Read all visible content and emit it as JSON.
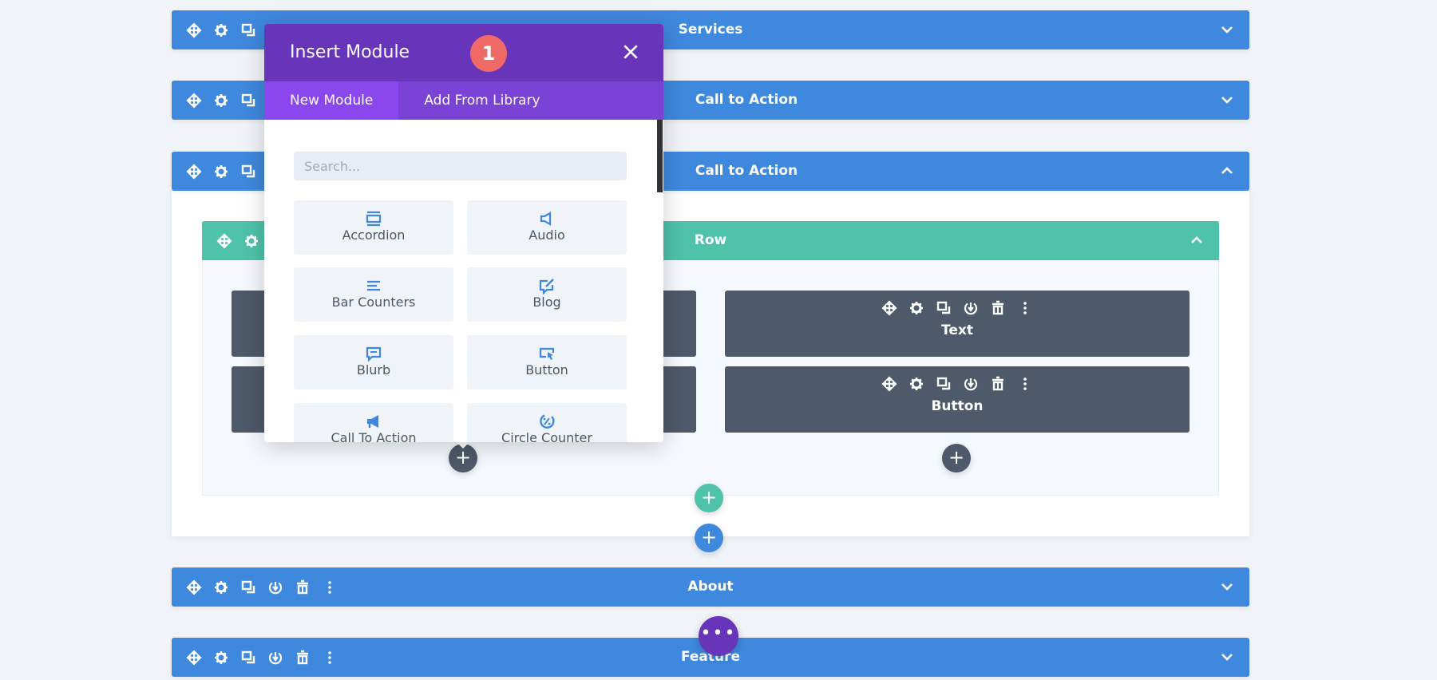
{
  "sections": [
    {
      "title": "Services",
      "expanded": false
    },
    {
      "title": "Call to Action",
      "expanded": false
    },
    {
      "title": "Call to Action",
      "expanded": true
    },
    {
      "title": "About",
      "expanded": false
    },
    {
      "title": "Feature",
      "expanded": false
    }
  ],
  "row": {
    "title": "Row"
  },
  "modules": {
    "right_column": [
      "Text",
      "Button"
    ]
  },
  "modal": {
    "title": "Insert Module",
    "step_badge": "1",
    "tabs": [
      {
        "label": "New Module",
        "active": true
      },
      {
        "label": "Add From Library",
        "active": false
      }
    ],
    "search_placeholder": "Search...",
    "items": [
      {
        "label": "Accordion",
        "icon": "accordion-icon"
      },
      {
        "label": "Audio",
        "icon": "audio-icon"
      },
      {
        "label": "Bar Counters",
        "icon": "bar-counters-icon"
      },
      {
        "label": "Blog",
        "icon": "blog-icon"
      },
      {
        "label": "Blurb",
        "icon": "blurb-icon"
      },
      {
        "label": "Button",
        "icon": "button-icon"
      },
      {
        "label": "Call To Action",
        "icon": "megaphone-icon"
      },
      {
        "label": "Circle Counter",
        "icon": "circle-counter-icon"
      }
    ]
  },
  "plus_symbol": "+",
  "more_symbol": "•••",
  "colors": {
    "section": "#3e88dd",
    "row": "#4fc2aa",
    "module": "#4e5969",
    "modal_header": "#6734ba",
    "tab_active": "#8a47ee",
    "badge": "#ef6a67"
  }
}
